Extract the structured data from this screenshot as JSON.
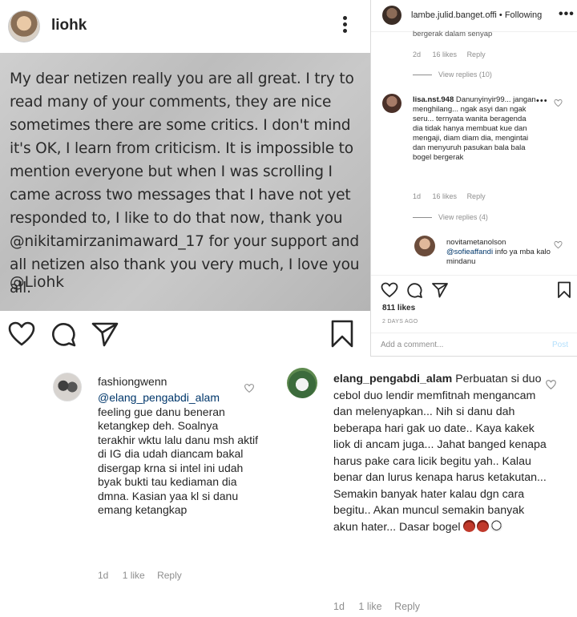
{
  "post": {
    "username": "liohk",
    "image_text": "My dear netizen really you are all great. I try to read many of your comments, they are nice sometimes there are some critics. I don't mind it's OK, I learn from criticism. It is impossible to mention everyone but when I was scrolling I came across two messages that I have not yet responded to, I like to do that now, thank you @nikitamirzanimaward_17 for your support and all netizen also thank you very much, I love you all.",
    "image_signature": "@Liohk",
    "icons": [
      "heart-icon",
      "comment-icon",
      "share-icon",
      "bookmark-icon",
      "more-icon"
    ]
  },
  "ig_panel": {
    "header_user": "lambe.julid.banget.offi",
    "header_sep": "•",
    "header_follow": "Following",
    "cut_text": "bergerak dalam senyap",
    "c1_time": "2d",
    "c1_likes": "16 likes",
    "c1_reply": "Reply",
    "view_replies_1": "View replies (10)",
    "c2_user": "lisa.nst.948",
    "c2_text_1": "Danunyinyir99...",
    "c2_text_rest": "jangan menghilang... ngak asyi dan ngak seru... ternyata wanita beragenda dia tidak hanya membuat kue dan mengaji, diam diam dia, mengintai dan menyuruh pasukan bala bala bogel bergerak",
    "c2_time": "1d",
    "c2_likes": "16 likes",
    "c2_reply": "Reply",
    "view_replies_2": "View replies (4)",
    "c3_user": "novitametanolson",
    "c3_mention": "@sofieaffandi",
    "c3_text": "info ya mba kalo mindanu",
    "likes": "811 likes",
    "date": "2 DAYS AGO",
    "add_comment_placeholder": "Add a comment...",
    "post_label": "Post",
    "accent": "#0095f6"
  },
  "comment_left": {
    "username": "fashiongwenn",
    "mention": "@elang_pengabdi_alam",
    "text": "feeling gue danu beneran ketangkep deh. Soalnya terakhir wktu lalu danu msh aktif di IG dia udah diancam bakal disergap krna si intel ini udah byak bukti tau kediaman dia dmna. Kasian yaa kl si danu emang ketangkap",
    "time": "1d",
    "likes": "1 like",
    "reply": "Reply"
  },
  "comment_right": {
    "username": "elang_pengabdi_alam",
    "text": "Perbuatan si duo cebol duo lendir memfitnah mengancam dan melenyapkan... Nih si danu dah beberapa hari gak uo date.. Kaya kakek liok di ancam juga... Jahat banged kenapa harus pake cara licik begitu yah.. Kalau benar dan lurus kenapa harus ketakutan... Semakin banyak hater kalau dgn cara begitu.. Akan muncul semakin banyak akun hater... Dasar bogel",
    "emojis": [
      "devil-emoji",
      "devil-emoji",
      "skull-emoji"
    ],
    "time": "1d",
    "likes": "1 like",
    "reply": "Reply"
  }
}
